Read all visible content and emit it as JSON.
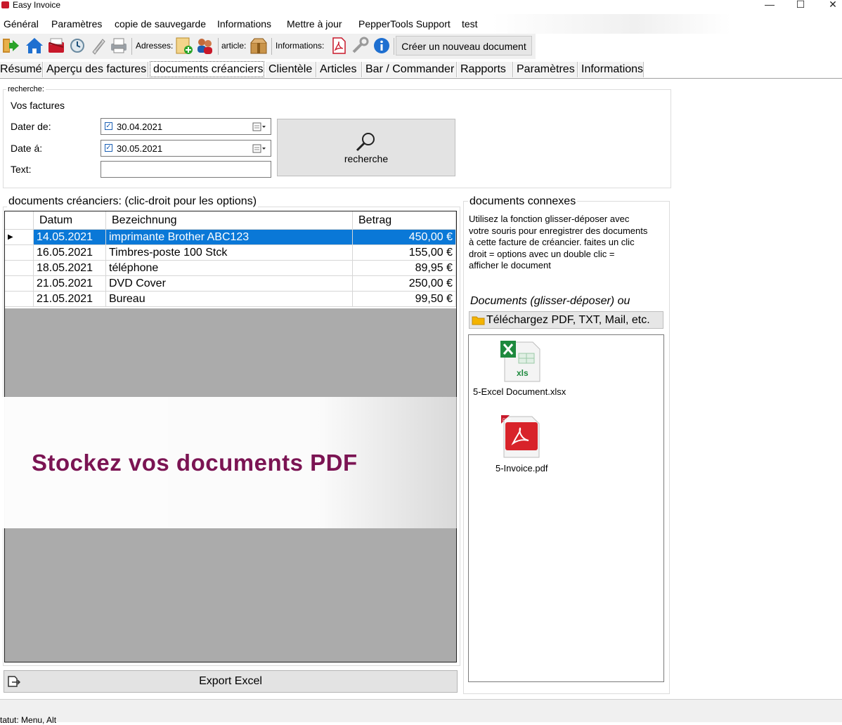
{
  "window": {
    "title": "Easy Invoice",
    "min": "—",
    "max": "☐",
    "close": "✕"
  },
  "menu": [
    "Général",
    "Paramètres",
    "copie de sauvegarde",
    "Informations",
    "Mettre à jour",
    "PepperTools Support",
    "test"
  ],
  "toolbar": {
    "adresses_label": "Adresses:",
    "article_label": "article:",
    "informations_label": "Informations:",
    "new_document_label": "Créer un nouveau document"
  },
  "tabs": [
    "Résumé",
    "Aperçu des factures",
    "documents créanciers",
    "Clientèle",
    "Articles",
    "Bar / Commander",
    "Rapports",
    "Paramètres",
    "Informations"
  ],
  "active_tab": "documents créanciers",
  "search": {
    "legend": "recherche:",
    "heading": "Vos factures",
    "from_label": "Dater de:",
    "from_value": "30.04.2021",
    "to_label": "Date á:",
    "to_value": "30.05.2021",
    "text_label": "Text:",
    "text_value": "",
    "button_label": "recherche"
  },
  "table": {
    "legend": "documents créanciers: (clic-droit pour les options)",
    "columns": [
      "Datum",
      "Bezeichnung",
      "Betrag"
    ],
    "rows": [
      {
        "date": "14.05.2021",
        "label": "imprimante Brother ABC123",
        "amount": "450,00 €",
        "selected": true
      },
      {
        "date": "16.05.2021",
        "label": "Timbres-poste 100 Stck",
        "amount": "155,00 €"
      },
      {
        "date": "18.05.2021",
        "label": "téléphone",
        "amount": "89,95 €"
      },
      {
        "date": "21.05.2021",
        "label": "DVD Cover",
        "amount": "250,00 €"
      },
      {
        "date": "21.05.2021",
        "label": "Bureau",
        "amount": "99,50 €"
      }
    ]
  },
  "related": {
    "legend": "documents connexes",
    "help_lines": [
      "Utilisez la fonction glisser-déposer avec",
      "votre souris pour enregistrer des documents",
      "à cette facture de créancier. faites un clic",
      "droit = options avec un double clic =",
      "afficher le  document"
    ],
    "dnd_label": "Documents (glisser-déposer) ou",
    "upload_label": "Téléchargez PDF, TXT, Mail, etc.",
    "files": [
      {
        "name": "5-Excel Document.xlsx",
        "icon": "excel-file-icon",
        "badge": "xls"
      },
      {
        "name": "5-Invoice.pdf",
        "icon": "pdf-file-icon",
        "badge": "PDF"
      }
    ]
  },
  "banner": {
    "text": "Stockez vos documents PDF",
    "color": "#7b1453"
  },
  "export_label": "Export Excel",
  "status": "tatut:   Menu, Alt",
  "colors": {
    "selection": "#0a78d7",
    "grid_empty": "#ababab"
  }
}
